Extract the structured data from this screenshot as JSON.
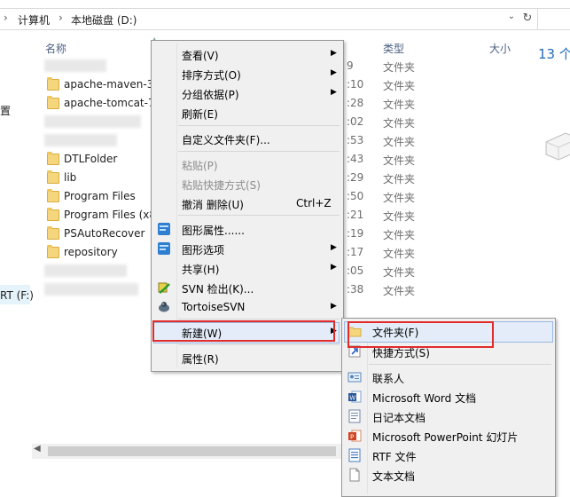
{
  "address": {
    "crumbs": [
      "计算机",
      "本地磁盘 (D:)"
    ],
    "separator": "›",
    "dropdown_glyph": "⌄",
    "refresh_glyph": "↻"
  },
  "nav": {
    "item_partial": "置",
    "drive_partial": "RT (F:)"
  },
  "columns": {
    "name": "名称",
    "type": "类型",
    "size": "大小"
  },
  "files": [
    {
      "name": "",
      "date": "9",
      "type": "文件夹",
      "blurred": true
    },
    {
      "name": "apache-maven-3",
      "date": ":10",
      "type": "文件夹"
    },
    {
      "name": "apache-tomcat-7",
      "date": ":28",
      "type": "文件夹"
    },
    {
      "name": "",
      "date": ":02",
      "type": "文件夹",
      "blurred": true
    },
    {
      "name": "",
      "date": ":53",
      "type": "文件夹",
      "blurred": true
    },
    {
      "name": "DTLFolder",
      "date": ":43",
      "type": "文件夹"
    },
    {
      "name": "lib",
      "date": ":29",
      "type": "文件夹"
    },
    {
      "name": "Program Files",
      "date": ":50",
      "type": "文件夹"
    },
    {
      "name": "Program Files (x8",
      "date": ":21",
      "type": "文件夹"
    },
    {
      "name": "PSAutoRecover",
      "date": ":19",
      "type": "文件夹"
    },
    {
      "name": "repository",
      "date": ":17",
      "type": "文件夹"
    },
    {
      "name": "",
      "date": ":05",
      "type": "文件夹",
      "blurred": true
    },
    {
      "name": "",
      "date": ":38",
      "type": "文件夹",
      "blurred": true
    }
  ],
  "details": {
    "items_count": "13 个"
  },
  "context_menu": {
    "view": "查看(V)",
    "sort": "排序方式(O)",
    "group": "分组依据(P)",
    "refresh": "刷新(E)",
    "customize": "自定义文件夹(F)...",
    "paste": "粘贴(P)",
    "paste_shortcut": "粘贴快捷方式(S)",
    "undo": "撤消 删除(U)",
    "undo_shortcut": "Ctrl+Z",
    "graphics_props": "图形属性......",
    "graphics_options": "图形选项",
    "share": "共享(H)",
    "svn_checkout": "SVN 检出(K)...",
    "tortoise": "TortoiseSVN",
    "new": "新建(W)",
    "properties": "属性(R)"
  },
  "new_submenu": {
    "folder": "文件夹(F)",
    "shortcut": "快捷方式(S)",
    "contact": "联系人",
    "word": "Microsoft Word 文档",
    "journal": "日记本文档",
    "ppt": "Microsoft PowerPoint 幻灯片",
    "rtf": "RTF 文件",
    "text": "文本文档"
  },
  "colors": {
    "highlight": "#e3ecf8",
    "annotation_red": "#e12b2b",
    "header_text": "#4d6082",
    "menu_bg": "#f0f0f0"
  }
}
